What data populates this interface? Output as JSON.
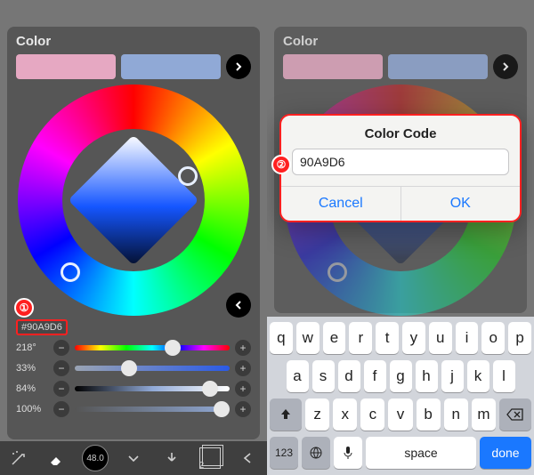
{
  "panel_title": "Color",
  "swatches": {
    "primary": "#E6A8C2",
    "secondary": "#90A9D6"
  },
  "hex_value": "#90A9D6",
  "sliders": {
    "hue": {
      "label": "218°",
      "pos": 0.6
    },
    "sat": {
      "label": "33%",
      "pos": 0.33
    },
    "lgt": {
      "label": "84%",
      "pos": 0.84
    },
    "op": {
      "label": "100%",
      "pos": 1.0
    }
  },
  "brush_size": "48.0",
  "layers_count": "2",
  "annotations": {
    "one": "①",
    "two": "②"
  },
  "dialog": {
    "title": "Color Code",
    "value": "90A9D6",
    "cancel": "Cancel",
    "ok": "OK"
  },
  "keyboard": {
    "row1": [
      "q",
      "w",
      "e",
      "r",
      "t",
      "y",
      "u",
      "i",
      "o",
      "p"
    ],
    "row2": [
      "a",
      "s",
      "d",
      "f",
      "g",
      "h",
      "j",
      "k",
      "l"
    ],
    "row3": [
      "z",
      "x",
      "c",
      "v",
      "b",
      "n",
      "m"
    ],
    "mode": "123",
    "space": "space",
    "done": "done"
  }
}
